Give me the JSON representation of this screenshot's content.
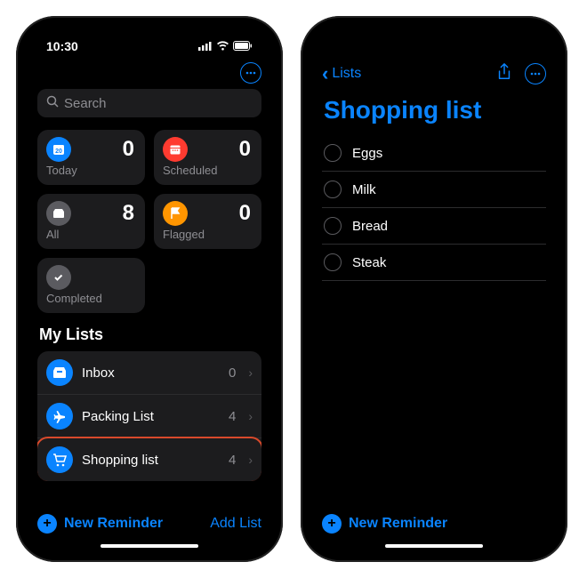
{
  "status": {
    "time": "10:30"
  },
  "search": {
    "placeholder": "Search"
  },
  "cards": {
    "today": {
      "label": "Today",
      "count": "0",
      "color": "#0a84ff"
    },
    "scheduled": {
      "label": "Scheduled",
      "count": "0",
      "color": "#ff3b30"
    },
    "all": {
      "label": "All",
      "count": "8",
      "color": "#5b5b60"
    },
    "flagged": {
      "label": "Flagged",
      "count": "0",
      "color": "#ff9500"
    },
    "completed": {
      "label": "Completed",
      "color": "#5b5b60"
    }
  },
  "myListsTitle": "My Lists",
  "lists": [
    {
      "label": "Inbox",
      "count": "0",
      "color": "#0a84ff"
    },
    {
      "label": "Packing List",
      "count": "4",
      "color": "#0a84ff"
    },
    {
      "label": "Shopping list",
      "count": "4",
      "color": "#0a84ff",
      "highlight": true
    }
  ],
  "newReminder": "New Reminder",
  "addList": "Add List",
  "detail": {
    "back": "Lists",
    "title": "Shopping list",
    "items": [
      "Eggs",
      "Milk",
      "Bread",
      "Steak"
    ]
  }
}
